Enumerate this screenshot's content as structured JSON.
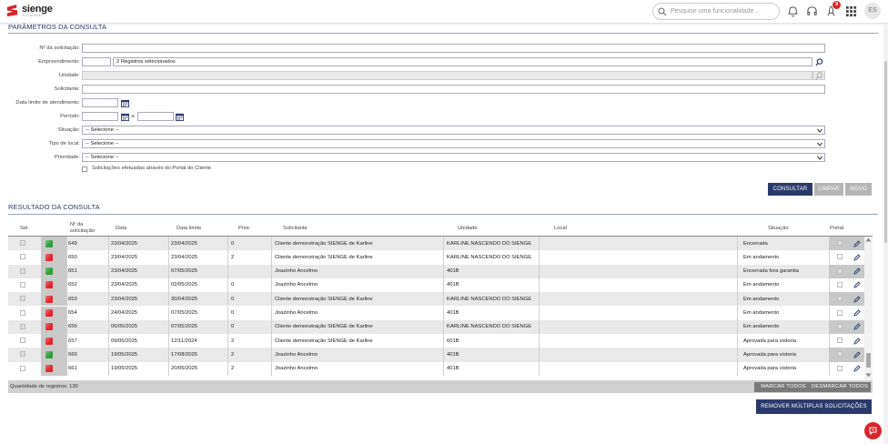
{
  "brand": {
    "name": "sienge",
    "sub": "PLATAFORMA"
  },
  "search": {
    "placeholder": "Pesquise uma funcionalidade..."
  },
  "notifications": {
    "count": "9"
  },
  "user": {
    "initials": "ES"
  },
  "params": {
    "title": "PARÂMETROS DA CONSULTA",
    "labels": {
      "num": "Nº da solicitação:",
      "emp": "Empreendimento:",
      "unidade": "Unidade:",
      "solicitante": "Solicitante:",
      "data_limite": "Data limite de atendimento:",
      "periodo": "Período:",
      "periodo_sep": "a",
      "situacao": "Situação:",
      "tipo_local": "Tipo de local:",
      "prioridade": "Prioridade:",
      "portal": "Solicitações efetuadas através do Portal do Cliente"
    },
    "values": {
      "emp_text": "2 Registros selecionados",
      "situacao": "-- Selecione --",
      "tipo_local": "-- Selecione --",
      "prioridade": "-- Selecione --"
    }
  },
  "buttons": {
    "consultar": "CONSULTAR",
    "limpar": "LIMPAR",
    "novo": "NOVO",
    "marcar": "MARCAR TODOS",
    "desmarcar": "DESMARCAR TODOS",
    "remover": "REMOVER MÚLTIPLAS SOLICITAÇÕES"
  },
  "result": {
    "title": "RESULTADO DA CONSULTA",
    "headers": {
      "sel": "Sel.",
      "num": "Nº da solicitação",
      "data": "Data",
      "limite": "Data limite",
      "prior": "Prior.",
      "solicitante": "Solicitante",
      "unidade": "Unidade",
      "local": "Local",
      "situacao": "Situação",
      "portal": "Portal"
    },
    "rows": [
      {
        "status": "#2e9e3a",
        "num": "649",
        "data": "23/04/2025",
        "limite": "23/04/2025",
        "prior": "0",
        "solicitante": "Cliente demonstração SIENGE de Karline",
        "unidade": "KARLINE NASCENDO DO SIENGE",
        "situacao": "Encerrada"
      },
      {
        "status": "#e0262b",
        "num": "650",
        "data": "23/04/2025",
        "limite": "23/04/2025",
        "prior": "2",
        "solicitante": "Cliente demonstração SIENGE de Karline",
        "unidade": "KARLINE NASCENDO DO SIENGE",
        "situacao": "Em andamento"
      },
      {
        "status": "#2e9e3a",
        "num": "651",
        "data": "23/04/2025",
        "limite": "07/05/2025",
        "prior": "",
        "solicitante": "Joazinho Ancelmo",
        "unidade": "401B",
        "situacao": "Encerrada fora garantia"
      },
      {
        "status": "#e0262b",
        "num": "652",
        "data": "23/04/2025",
        "limite": "02/05/2025",
        "prior": "0",
        "solicitante": "Joazinho Ancelmo",
        "unidade": "401B",
        "situacao": "Em andamento"
      },
      {
        "status": "#e0262b",
        "num": "653",
        "data": "23/04/2025",
        "limite": "30/04/2025",
        "prior": "0",
        "solicitante": "Cliente demonstração SIENGE de Karline",
        "unidade": "KARLINE NASCENDO DO SIENGE",
        "situacao": "Em andamento"
      },
      {
        "status": "#e0262b",
        "num": "654",
        "data": "24/04/2025",
        "limite": "07/05/2025",
        "prior": "0",
        "solicitante": "Joazinho Ancelmo",
        "unidade": "401B",
        "situacao": "Em andamento"
      },
      {
        "status": "#e0262b",
        "num": "656",
        "data": "06/05/2025",
        "limite": "07/05/2025",
        "prior": "0",
        "solicitante": "Cliente demonstração SIENGE de Karline",
        "unidade": "KARLINE NASCENDO DO SIENGE",
        "situacao": "Em andamento"
      },
      {
        "status": "#e0262b",
        "num": "657",
        "data": "09/05/2025",
        "limite": "12/11/2024",
        "prior": "2",
        "solicitante": "Cliente demonstração SIENGE de Karline",
        "unidade": "601B",
        "situacao": "Aprovada para vistoria"
      },
      {
        "status": "#2e9e3a",
        "num": "660",
        "data": "19/05/2025",
        "limite": "17/08/2025",
        "prior": "2",
        "solicitante": "Joazinho Ancelmo",
        "unidade": "401B",
        "situacao": "Aprovada para vistoria"
      },
      {
        "status": "#e0262b",
        "num": "661",
        "data": "19/05/2025",
        "limite": "20/05/2025",
        "prior": "2",
        "solicitante": "Joazinho Ancelmo",
        "unidade": "401B",
        "situacao": "Aprovada para vistoria"
      }
    ],
    "footer": "Quantidade de registros: 130"
  },
  "icons": {
    "logo": "sienge-logo",
    "search": "search-icon",
    "bell": "bell-icon",
    "headset": "headset-icon",
    "gift": "rocket-icon",
    "apps": "apps-grid-icon",
    "calendar": "calendar-icon",
    "magnifier": "magnifier-icon",
    "edit": "pencil-icon",
    "chat": "chat-icon"
  }
}
